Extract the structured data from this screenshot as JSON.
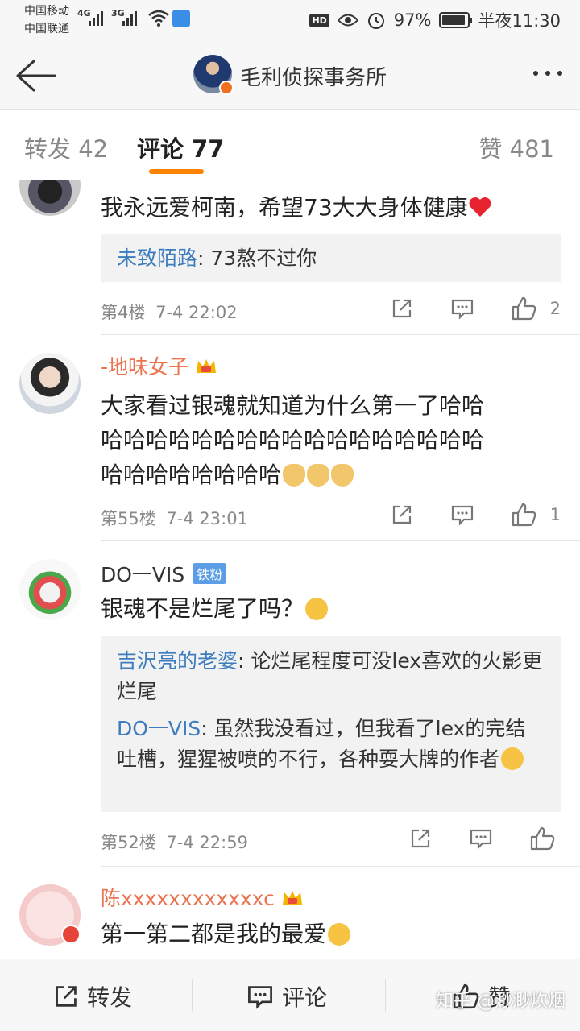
{
  "status_bar": {
    "carrier1": "中国移动",
    "carrier2": "中国联通",
    "sig1": "4G",
    "sig2": "3G",
    "battery_percent": "97%",
    "time": "半夜11:30"
  },
  "nav": {
    "title": "毛利侦探事务所"
  },
  "tabs": {
    "repost": "转发 42",
    "comment": "评论 77",
    "like": "赞 481"
  },
  "comments": [
    {
      "text": "我永远爱柯南，希望73大大身体健康",
      "reply": {
        "name": "未致陌路",
        "text": ": 73熬不过你"
      },
      "floor": "第4楼",
      "date": "7-4 22:02",
      "likes": "2"
    },
    {
      "name": "-地味女子",
      "text1": "大家看过银魂就知道为什么第一了哈哈",
      "text2": "哈哈哈哈哈哈哈哈哈哈哈哈哈哈哈哈哈",
      "text3": "哈哈哈哈哈哈哈哈",
      "floor": "第55楼",
      "date": "7-4 23:01",
      "likes": "1"
    },
    {
      "name": "DO一VIS",
      "badge": "铁粉",
      "text": "银魂不是烂尾了吗？",
      "reply1": {
        "name": "吉沢亮的老婆",
        "text": ": 论烂尾程度可没lex喜欢的火影更烂尾"
      },
      "reply2": {
        "name": "DO一VIS",
        "text": ": 虽然我没看过，但我看了lex的完结吐槽，猩猩被喷的不行，各种耍大牌的作者"
      },
      "floor": "第52楼",
      "date": "7-4 22:59"
    },
    {
      "name": "陈xxxxxxxxxxxxc",
      "text": "第一第二都是我的最爱"
    }
  ],
  "bottom_bar": {
    "repost": "转发",
    "comment": "评论",
    "like": "赞"
  },
  "watermark": "知乎 @渺渺炊烟",
  "colors": {
    "accent": "#ff8200",
    "username": "#eb7350",
    "reply_name": "#3d7cbf"
  }
}
